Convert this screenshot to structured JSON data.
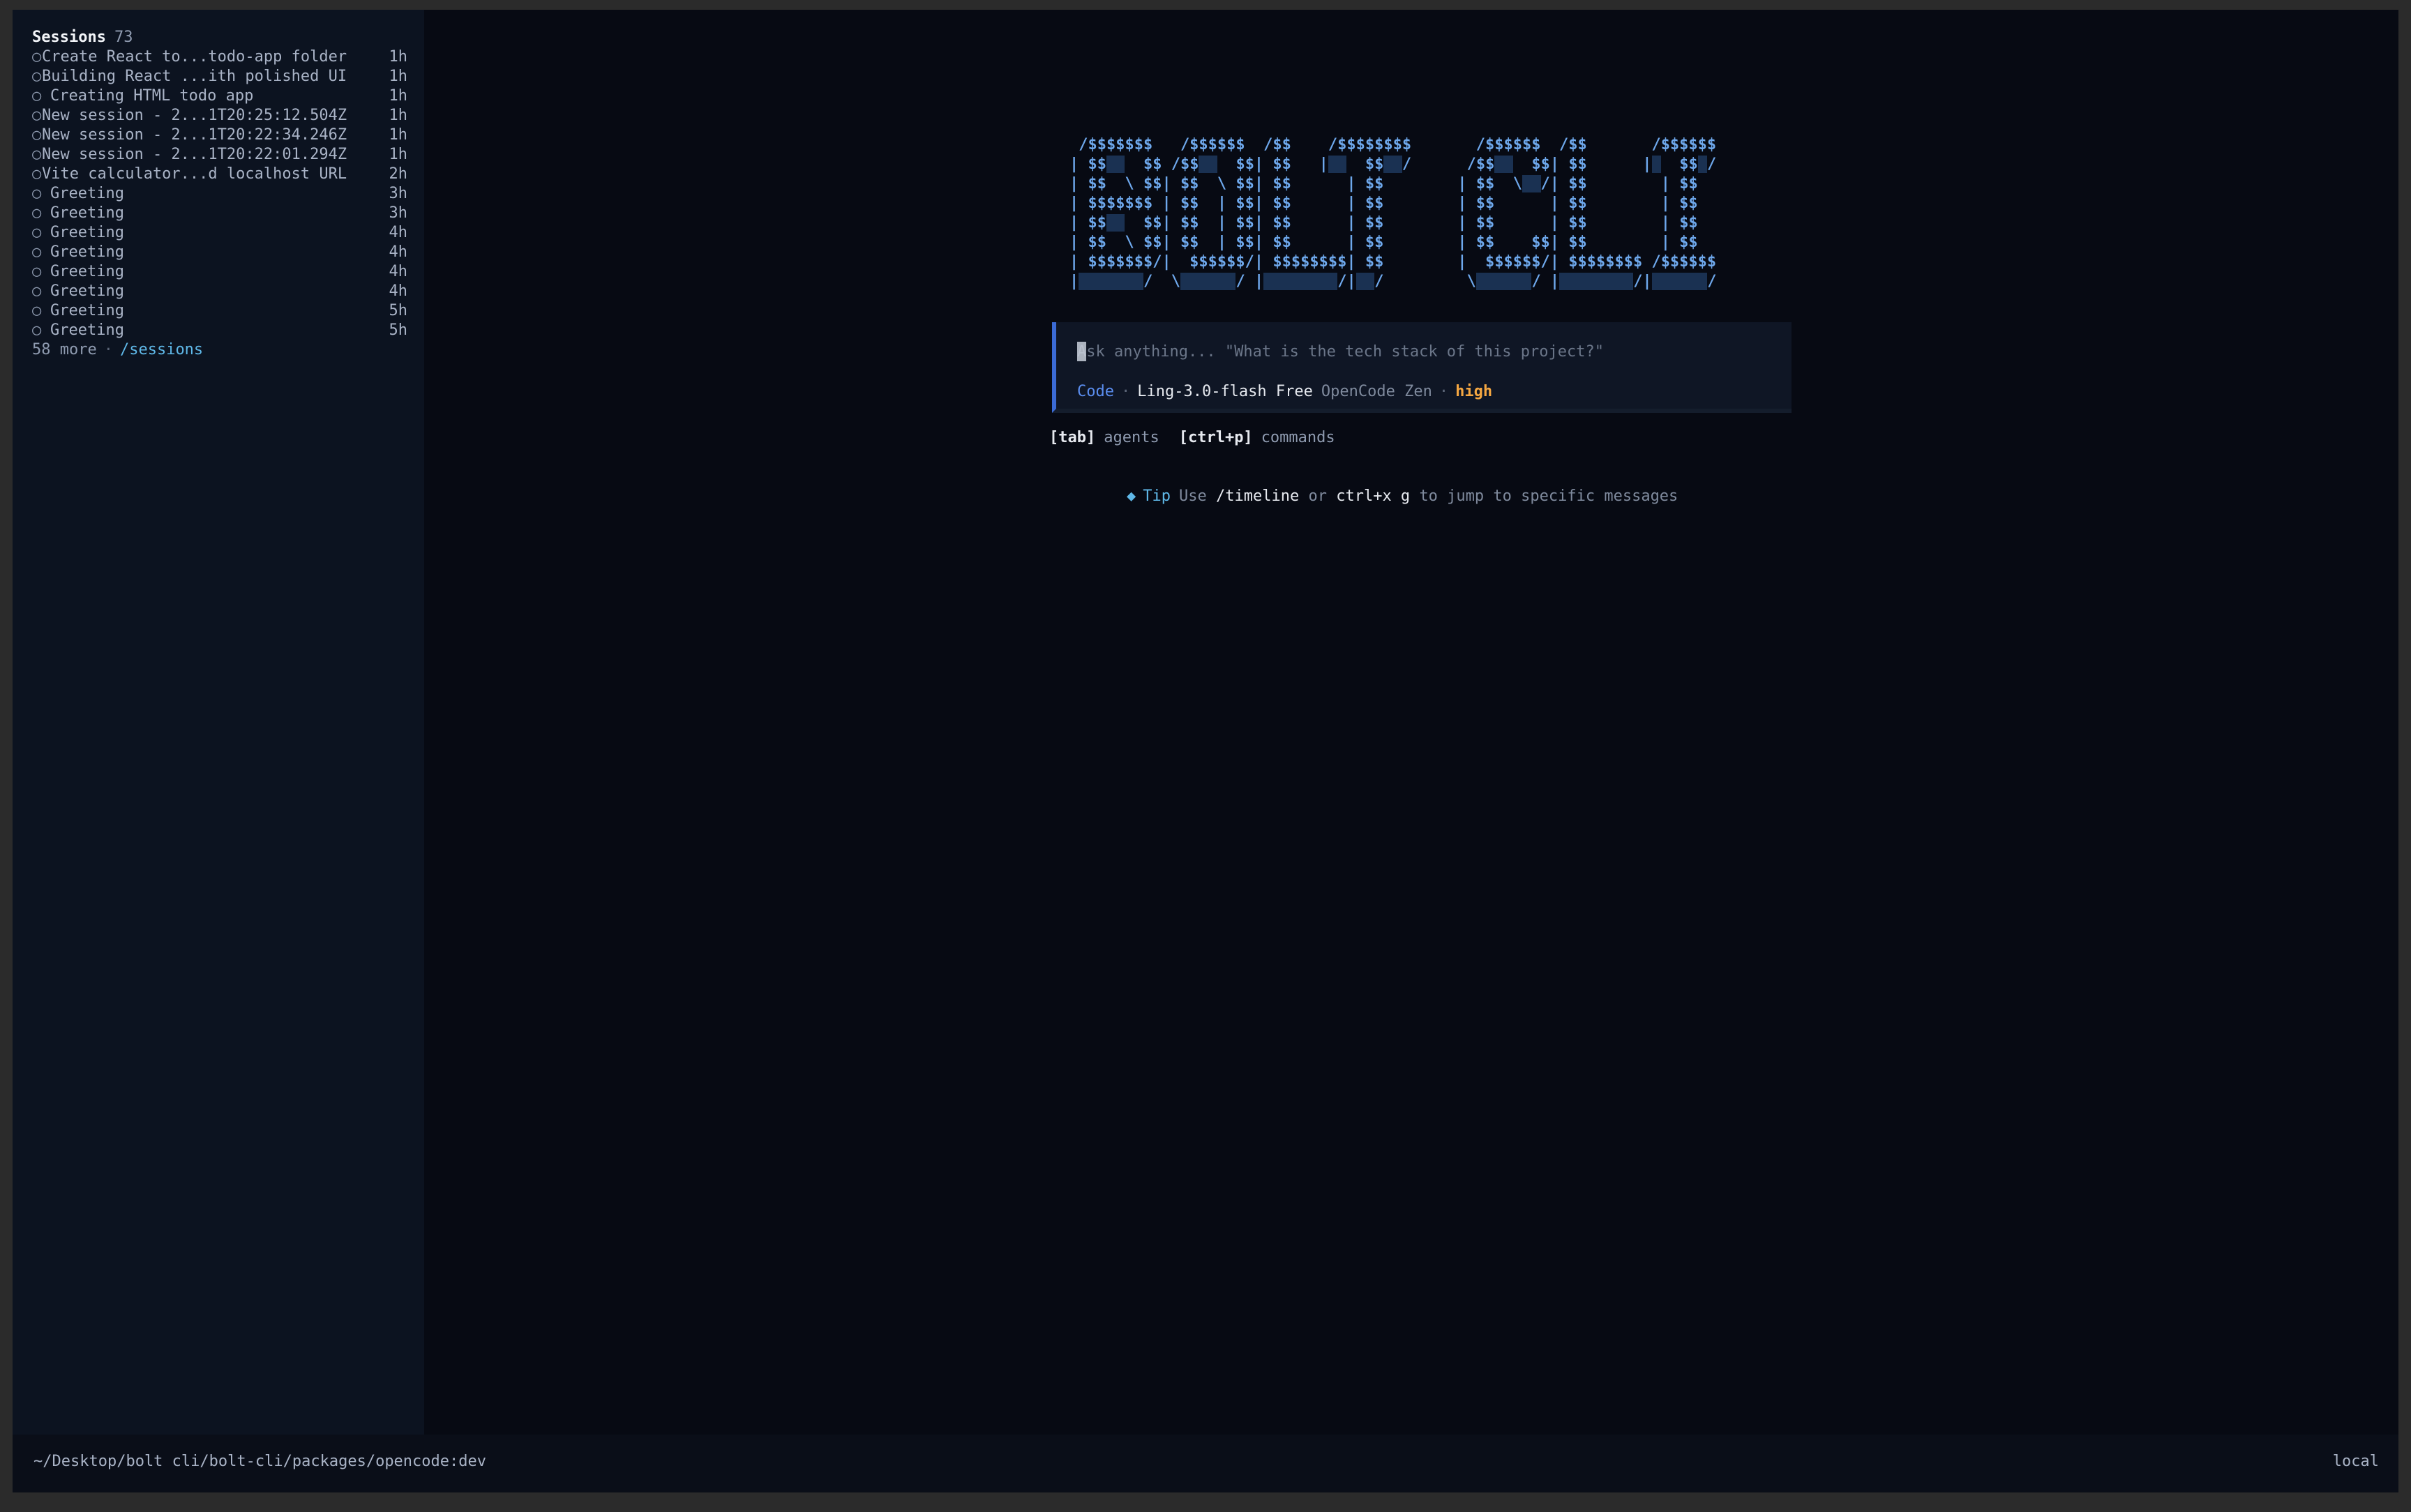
{
  "sidebar": {
    "title": "Sessions",
    "count": "73",
    "sessions": [
      {
        "title": "Create React to...todo-app folder",
        "age": "1h",
        "spaced": false
      },
      {
        "title": "Building React ...ith polished UI",
        "age": "1h",
        "spaced": false
      },
      {
        "title": "Creating HTML todo app",
        "age": "1h",
        "spaced": true
      },
      {
        "title": "New session - 2...1T20:25:12.504Z",
        "age": "1h",
        "spaced": false
      },
      {
        "title": "New session - 2...1T20:22:34.246Z",
        "age": "1h",
        "spaced": false
      },
      {
        "title": "New session - 2...1T20:22:01.294Z",
        "age": "1h",
        "spaced": false
      },
      {
        "title": "Vite calculator...d localhost URL",
        "age": "2h",
        "spaced": false
      },
      {
        "title": "Greeting",
        "age": "3h",
        "spaced": true
      },
      {
        "title": "Greeting",
        "age": "3h",
        "spaced": true
      },
      {
        "title": "Greeting",
        "age": "4h",
        "spaced": true
      },
      {
        "title": "Greeting",
        "age": "4h",
        "spaced": true
      },
      {
        "title": "Greeting",
        "age": "4h",
        "spaced": true
      },
      {
        "title": "Greeting",
        "age": "4h",
        "spaced": true
      },
      {
        "title": "Greeting",
        "age": "5h",
        "spaced": true
      },
      {
        "title": "Greeting",
        "age": "5h",
        "spaced": true
      }
    ],
    "more_label": "58 more",
    "more_separator": "·",
    "sessions_link": "/sessions"
  },
  "logo": {
    "lines": [
      " /$$$$$$$   /$$$$$$  /$$    /$$$$$$$$       /$$$$$$  /$$       /$$$$$$",
      "| $$__  $$ /$$__  $$| $$   |__  $$__/      /$$__  $$| $$      |_  $$_/",
      "| $$  \\ $$| $$  \\ $$| $$      | $$        | $$  \\__/| $$        | $$  ",
      "| $$$$$$$ | $$  | $$| $$      | $$        | $$      | $$        | $$  ",
      "| $$__  $$| $$  | $$| $$      | $$        | $$      | $$        | $$  ",
      "| $$  \\ $$| $$  | $$| $$      | $$        | $$    $$| $$        | $$  ",
      "| $$$$$$$/|  $$$$$$/| $$$$$$$$| $$        |  $$$$$$/| $$$$$$$$ /$$$$$$",
      "|_______/  \\______/ |________/|__/         \\______/ |________/|______/"
    ]
  },
  "prompt": {
    "placeholder": "Ask anything... \"What is the tech stack of this project?\"",
    "value": "",
    "agent": "Code",
    "separator": "·",
    "model": "Ling-3.0-flash Free",
    "provider": "OpenCode Zen",
    "effort": "high"
  },
  "hints": [
    {
      "key": "[tab]",
      "label": "agents"
    },
    {
      "key": "[ctrl+p]",
      "label": "commands"
    }
  ],
  "tip": {
    "icon": "◆",
    "label": "Tip",
    "pre": "Use",
    "command": "/timeline",
    "mid": "or",
    "shortcut": "ctrl+x g",
    "post": "to jump to specific messages"
  },
  "footer": {
    "path": "~/Desktop/bolt cli/bolt-cli/packages/opencode:dev",
    "mode": "local"
  },
  "colors": {
    "background": "#070a13",
    "sidebar": "#0c1320",
    "accent": "#3b6bd6",
    "logo": "#6ea8ec",
    "effort": "#f5a742",
    "link": "#5fb8e8"
  }
}
